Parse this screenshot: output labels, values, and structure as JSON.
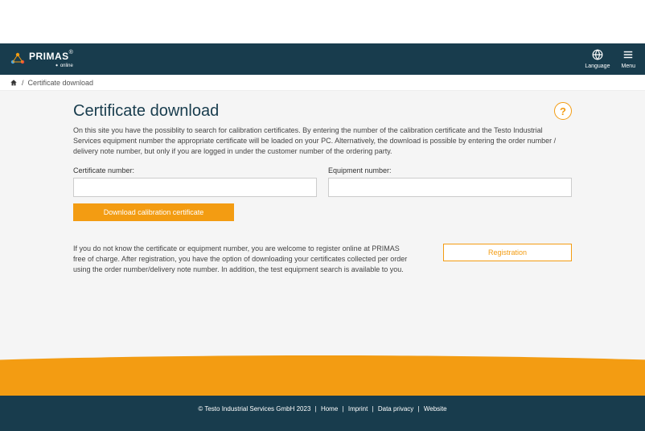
{
  "brand": {
    "name": "PRIMAS",
    "sub": "online",
    "reg": "®"
  },
  "header": {
    "language_label": "Language",
    "menu_label": "Menu"
  },
  "breadcrumb": {
    "current": "Certificate download",
    "separator": "/"
  },
  "page": {
    "title": "Certificate download",
    "help_symbol": "?",
    "intro": "On this site you have the possiblity to search for calibration certificates. By entering the number of the calibration certificate and the Testo Industrial Services equipment number the appropriate certificate will be loaded on your PC. Alternatively, the download is possible by entering the order number / delivery note number, but only if you are logged in under the customer number of the ordering party."
  },
  "form": {
    "certificate_label": "Certificate number:",
    "equipment_label": "Equipment number:",
    "certificate_value": "",
    "equipment_value": "",
    "download_label": "Download calibration certificate"
  },
  "registration": {
    "text": "If you do not know the certificate or equipment number, you are welcome to register online at PRIMAS free of charge. After registration, you have the option of downloading your certificates collected per order using the order number/delivery note number. In addition, the test equipment search is available to you.",
    "button_label": "Registration"
  },
  "footer": {
    "copyright": "© Testo Industrial Services GmbH 2023",
    "links": [
      "Home",
      "Imprint",
      "Data privacy",
      "Website"
    ]
  },
  "colors": {
    "header_bg": "#183c4d",
    "accent": "#f39c12",
    "body_bg": "#f5f5f5"
  }
}
